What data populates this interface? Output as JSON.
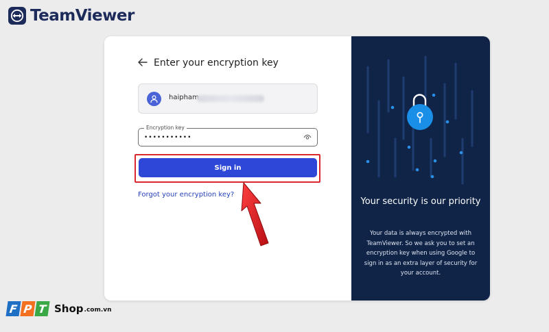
{
  "brand": {
    "name": "TeamViewer"
  },
  "signin_panel": {
    "title": "Enter your encryption key",
    "account_email_visible": "haipham",
    "encryption_field": {
      "label": "Encryption key",
      "value": "•••••••••••"
    },
    "signin_label": "Sign in",
    "forgot_link": "Forgot your encryption key?"
  },
  "info_panel": {
    "heading": "Your security is our priority",
    "body": "Your data is always encrypted with TeamViewer. So we ask you to set an encryption key when using Google to sign in as an extra layer of security for your account."
  },
  "watermark": {
    "shop": "Shop",
    "domain": ".com.vn",
    "letters": [
      "F",
      "P",
      "T"
    ]
  },
  "colors": {
    "primary_button": "#2f47d6",
    "dark_panel": "#0f2447",
    "lock_accent": "#1a8fe8",
    "highlight_border": "#d9272e",
    "fpt_blue": "#1f6fc4",
    "fpt_orange": "#f37021",
    "fpt_green": "#3ba847"
  }
}
